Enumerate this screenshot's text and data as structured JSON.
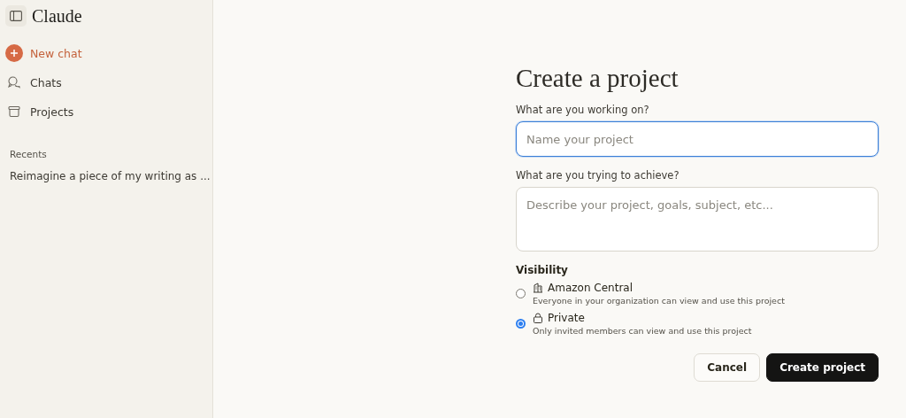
{
  "sidebar": {
    "logo": "Claude",
    "nav": [
      {
        "label": "New chat",
        "kind": "primary"
      },
      {
        "label": "Chats",
        "kind": "link"
      },
      {
        "label": "Projects",
        "kind": "link"
      }
    ],
    "recents_heading": "Recents",
    "recents": [
      "Reimagine a piece of my writing as ..."
    ]
  },
  "form": {
    "title": "Create a project",
    "name_label": "What are you working on?",
    "name_placeholder": "Name your project",
    "goal_label": "What are you trying to achieve?",
    "goal_placeholder": "Describe your project, goals, subject, etc...",
    "visibility_label": "Visibility",
    "options": [
      {
        "label": "Amazon Central",
        "description": "Everyone in your organization can view and use this project",
        "selected": false
      },
      {
        "label": "Private",
        "description": "Only invited members can view and use this project",
        "selected": true
      }
    ],
    "buttons": [
      "Cancel",
      "Create project"
    ]
  }
}
